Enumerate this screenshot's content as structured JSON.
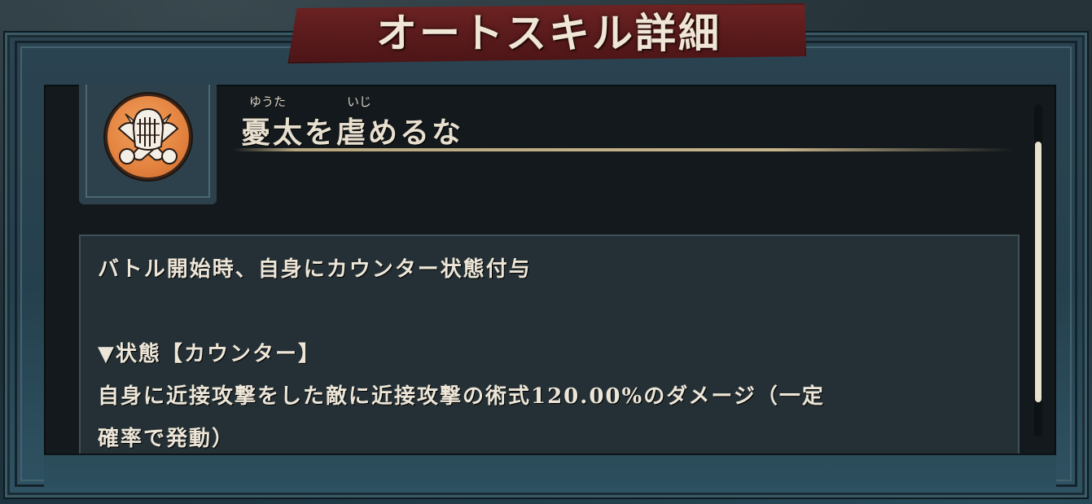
{
  "dialog": {
    "title": "オートスキル詳細"
  },
  "skill": {
    "name": "憂太を虐めるな",
    "ruby_1": "ゆうた",
    "ruby_2": "いじ",
    "icon": "skull-crossed-arms-icon",
    "icon_color": "#e3823f"
  },
  "description": {
    "line1": "バトル開始時、自身にカウンター状態付与",
    "line2": "▼状態【カウンター】",
    "line3": "自身に近接攻撃をした敵に近接攻撃の術式120.00%のダメージ（一定",
    "line4": "確率で発動）"
  }
}
